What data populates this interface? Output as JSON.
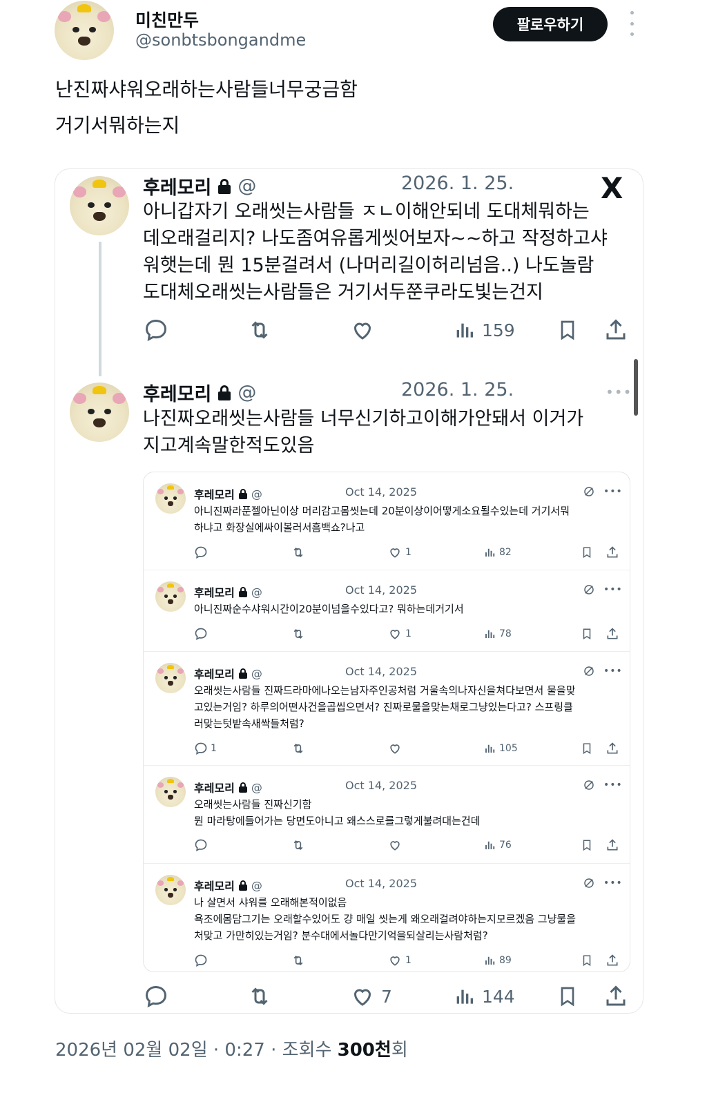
{
  "header": {
    "name": "미친만두",
    "handle": "@sonbtsbongandme",
    "follow_label": "팔로우하기",
    "more_icon": "vertical-dots-icon"
  },
  "tweet": {
    "lines": [
      "난진짜샤워오래하는사람들너무궁금함",
      "거기서뭐하는지"
    ]
  },
  "quote": {
    "platform_logo": "X",
    "posts": [
      {
        "name": "후레모리",
        "at": "@",
        "date": "2026. 1. 25.",
        "lines": [
          "아니갑자기 오래씻는사람들 ㅈㄴ이해안되네 도대체뭐하는",
          "데오래걸리지? 나도좀여유롭게씻어보자~~하고 작정하고샤",
          "워햇는데 뭔 15분걸려서 (나머리길이허리넘음..) 나도놀람",
          "도대체오래씻는사람들은 거기서두쭌쿠라도빛는건지"
        ],
        "views": "159"
      },
      {
        "name": "후레모리",
        "at": "@",
        "date": "2026. 1. 25.",
        "lines": [
          "나진짜오래씻는사람들 너무신기하고이해가안돼서 이거가",
          "지고계속말한적도있음"
        ],
        "likes": "7",
        "views": "144"
      }
    ]
  },
  "replies": [
    {
      "name": "후레모리",
      "at": "@",
      "date": "Oct 14, 2025",
      "lines": [
        "아니진짜라푼젤아닌이상 머리감고몸씻는데 20분이상이어떻게소요될수있는데 거기서뭐",
        "하냐고 화장실에싸이볼러서흠백쇼?나고"
      ],
      "replies_count": "",
      "likes": "1",
      "views": "82"
    },
    {
      "name": "후레모리",
      "at": "@",
      "date": "Oct 14, 2025",
      "lines": [
        "아니진짜순수샤워시간이20분이넘을수있다고? 뭐하는데거기서"
      ],
      "replies_count": "",
      "likes": "1",
      "views": "78"
    },
    {
      "name": "후레모리",
      "at": "@",
      "date": "Oct 14, 2025",
      "lines": [
        "오래씻는사람들 진짜드라마에나오는남자주인공처럼 거울속의나자신을쳐다보면서 물을맞",
        "고있는거임? 하루의어떤사건을곱씹으면서? 진짜로물을맞는채로그냥있는다고? 스프링클",
        "러맞는텃밭속새싹들처럼?"
      ],
      "replies_count": "1",
      "likes": "",
      "views": "105"
    },
    {
      "name": "후레모리",
      "at": "@",
      "date": "Oct 14, 2025",
      "lines": [
        "오래씻는사람들 진짜신기함",
        "뭔 마라탕에들어가는 당면도아니고 왜스스로를그렇게불려대는건데"
      ],
      "replies_count": "",
      "likes": "",
      "views": "76"
    },
    {
      "name": "후레모리",
      "at": "@",
      "date": "Oct 14, 2025",
      "lines": [
        "나 살면서 샤워를 오래해본적이없음",
        "욕조에몸담그기는 오래할수있어도 걍 매일 씻는게 왜오래걸려야하는지모르겠음 그냥물을",
        "처맞고 가만히있는거임? 분수대에서놀다만기억을되살리는사람처럼?"
      ],
      "replies_count": "",
      "likes": "1",
      "views": "89"
    }
  ],
  "footer": {
    "datetime": "2026년 02월 02일 · 0:27 · 조회수 ",
    "views_bold": "300천",
    "views_suffix": "회"
  }
}
